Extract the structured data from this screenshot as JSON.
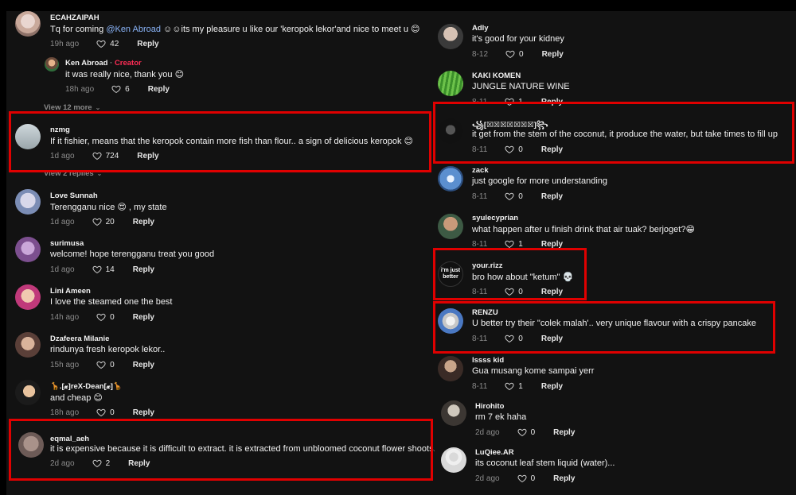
{
  "colors": {
    "background": "#121212",
    "username": "#f2f2f2",
    "muted": "#8a8a8a",
    "creator": "#fe2c55",
    "highlight": "#e00000",
    "mention": "#8ab4f8"
  },
  "left": {
    "c1": {
      "user": "ECAHZAIPAH",
      "text_a": "Tq for coming ",
      "mention": "@Ken Abroad",
      "text_b": " ☺☺its my pleasure u like our 'keropok lekor'and nice to meet u 😊",
      "time": "19h ago",
      "likes": "42",
      "reply": "Reply"
    },
    "r1": {
      "user": "Ken Abroad",
      "sep": " · ",
      "badge": "Creator",
      "text": "it was really nice, thank you 😊",
      "time": "18h ago",
      "likes": "6",
      "reply": "Reply"
    },
    "more1": "View 12 more",
    "c2": {
      "user": "nzmg",
      "text": "If it fishier, means that the keropok contain more fish than flour.. a sign of delicious keropok 😊",
      "time": "1d ago",
      "likes": "724",
      "reply": "Reply"
    },
    "more2": "View 2 replies",
    "c3": {
      "user": "Love Sunnah",
      "text": "Terengganu nice 😍 , my state",
      "time": "1d ago",
      "likes": "20",
      "reply": "Reply"
    },
    "c4": {
      "user": "surimusa",
      "text": "welcome! hope terengganu treat you good",
      "time": "1d ago",
      "likes": "14",
      "reply": "Reply"
    },
    "c5": {
      "user": "Lini Ameen",
      "text": "I love the steamed one the best",
      "time": "14h ago",
      "likes": "0",
      "reply": "Reply"
    },
    "c6": {
      "user": "Dzafeera Milanie",
      "text": "rindunya fresh keropok lekor..",
      "time": "15h ago",
      "likes": "0",
      "reply": "Reply"
    },
    "c7": {
      "user": "🦒.[𝔁]reX-Dean[𝔁]🦒",
      "text": "and cheap 😊",
      "time": "18h ago",
      "likes": "0",
      "reply": "Reply"
    },
    "c8": {
      "user": "eqmal_aeh",
      "text": "it is expensive because it is difficult to extract. it is extracted from unbloomed coconut flower shoots.",
      "time": "2d ago",
      "likes": "2",
      "reply": "Reply"
    }
  },
  "right": {
    "d1": {
      "user": "Adly",
      "text": "it's good for your kidney",
      "time": "8-12",
      "likes": "0",
      "reply": "Reply"
    },
    "d2": {
      "user": "KAKI KOMEN",
      "text": "JUNGLE NATURE WINE",
      "time": "8-11",
      "likes": "1",
      "reply": "Reply"
    },
    "d3": {
      "user": "꧁[☒☒☒☒☒☒☒]꧂",
      "text": "it get from the stem of the coconut, it produce the water, but take times to fill up",
      "time": "8-11",
      "likes": "0",
      "reply": "Reply"
    },
    "d4": {
      "user": "zack",
      "text": "just google for more understanding",
      "time": "8-11",
      "likes": "0",
      "reply": "Reply"
    },
    "d5": {
      "user": "syulecyprian",
      "text": "what happen after u finish drink that air tuak? berjoget?😁",
      "time": "8-11",
      "likes": "1",
      "reply": "Reply"
    },
    "d6": {
      "user": "your.rizz",
      "text": "bro how about \"ketum\" 💀",
      "time": "8-11",
      "likes": "0",
      "reply": "Reply",
      "avatar_text": "i'm just better"
    },
    "d7": {
      "user": "RENZU",
      "text": "U better try their \"colek malah'.. very unique flavour with a crispy pancake",
      "time": "8-11",
      "likes": "0",
      "reply": "Reply"
    },
    "d8": {
      "user": "lssss kid",
      "text": "Gua musang kome sampai yerr",
      "time": "8-11",
      "likes": "1",
      "reply": "Reply"
    },
    "d9": {
      "user": "Hirohito",
      "text": "rm 7 ek haha",
      "time": "2d ago",
      "likes": "0",
      "reply": "Reply"
    },
    "d10": {
      "user": "LuQiee.AR",
      "text": "its coconut leaf stem liquid (water)...",
      "time": "2d ago",
      "likes": "0",
      "reply": "Reply"
    }
  }
}
